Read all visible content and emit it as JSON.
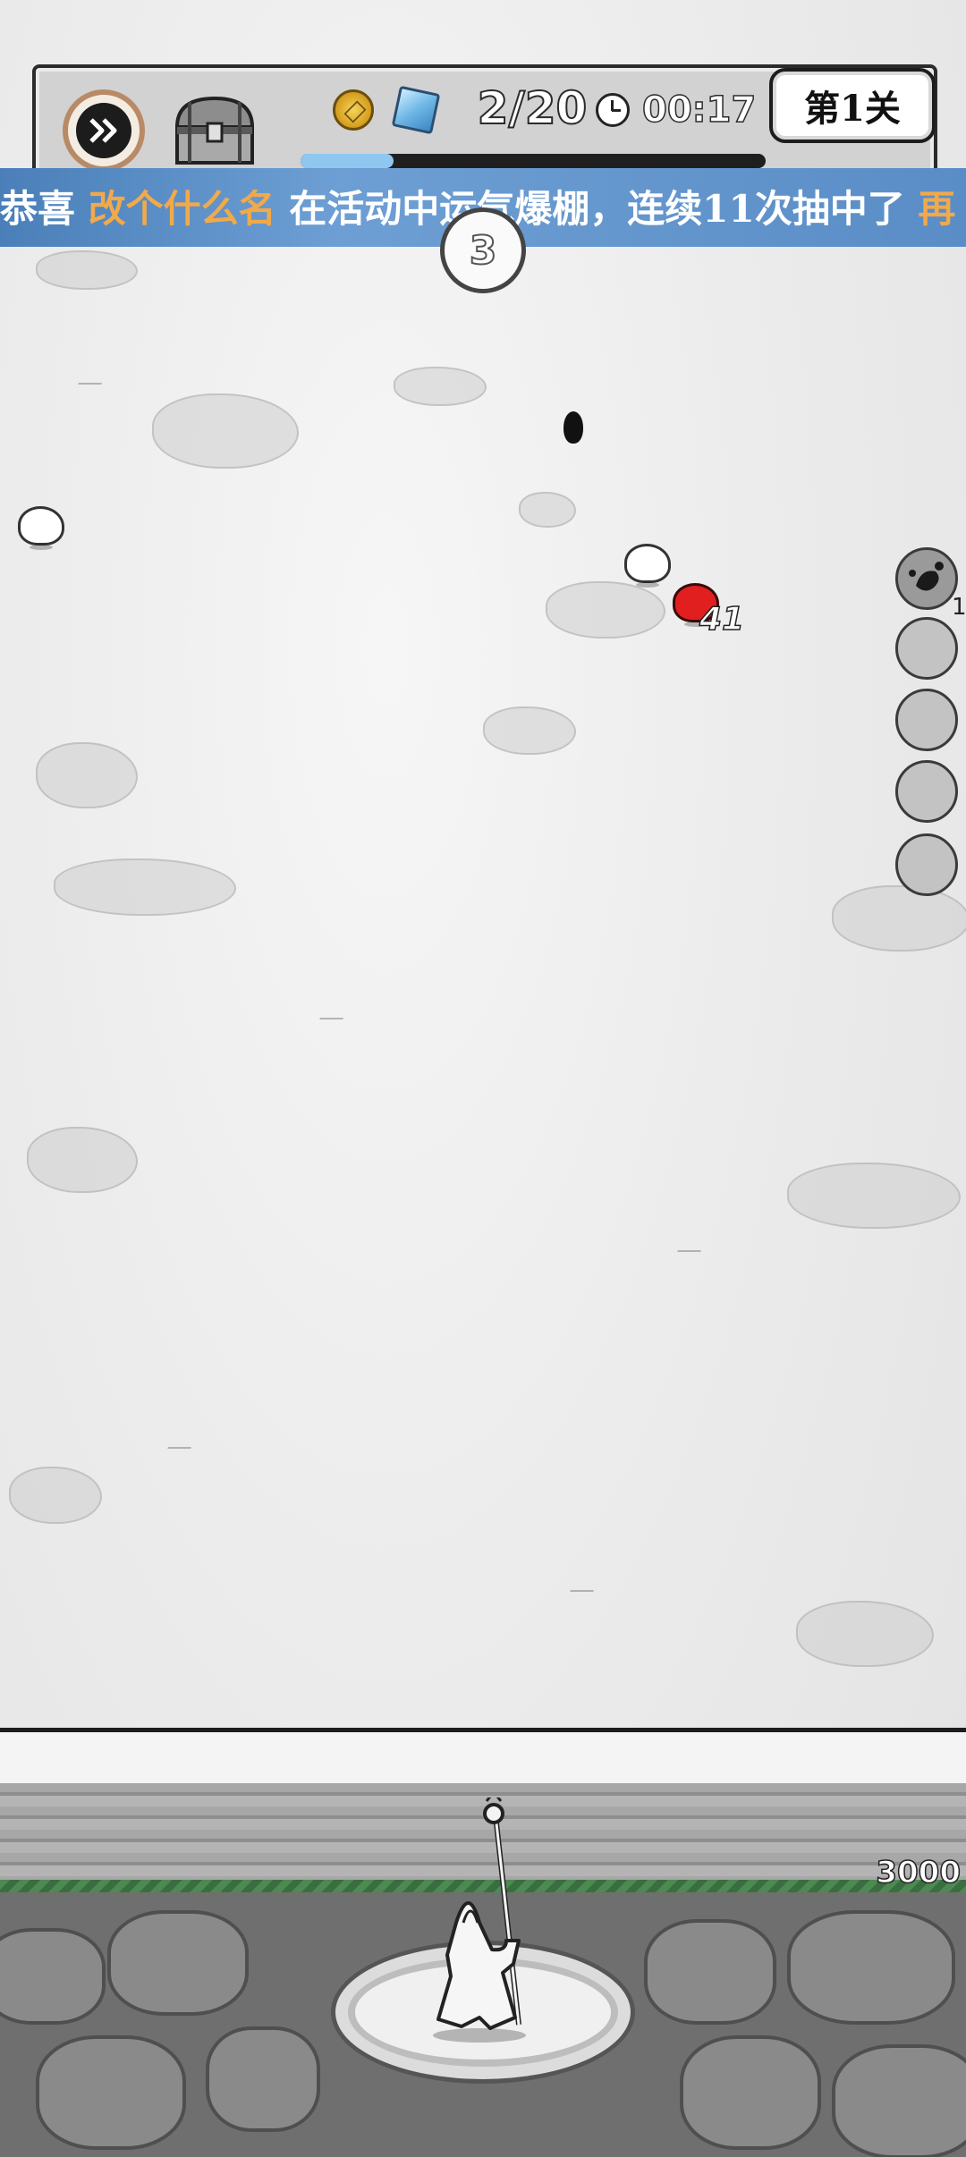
{
  "hud": {
    "wave_counter": "2/20",
    "timer": "00:17",
    "level_label": "第1关",
    "progress_fraction": 0.2,
    "icons": {
      "fast_forward": "fast-forward-icon",
      "chest": "treasure-chest-icon",
      "coin": "gold-coin-icon",
      "gem": "blue-gem-icon",
      "clock": "clock-icon"
    }
  },
  "banner": {
    "prefix": "恭喜",
    "player_name": "改个什么名",
    "message": "在活动中运气爆棚，连续11次抽中了",
    "suffix": "再"
  },
  "wave_orb": {
    "number": "3"
  },
  "battle": {
    "damage_number": "41"
  },
  "skills": {
    "count": "1",
    "slots": 5
  },
  "base": {
    "hp_value": "3000",
    "hp_fraction": 1.0
  },
  "colors": {
    "banner_bg": "#5a8dc6",
    "highlight_name": "#f2a94a",
    "enemy_red": "#e21f1f",
    "hp_green": "#4c8a52"
  }
}
